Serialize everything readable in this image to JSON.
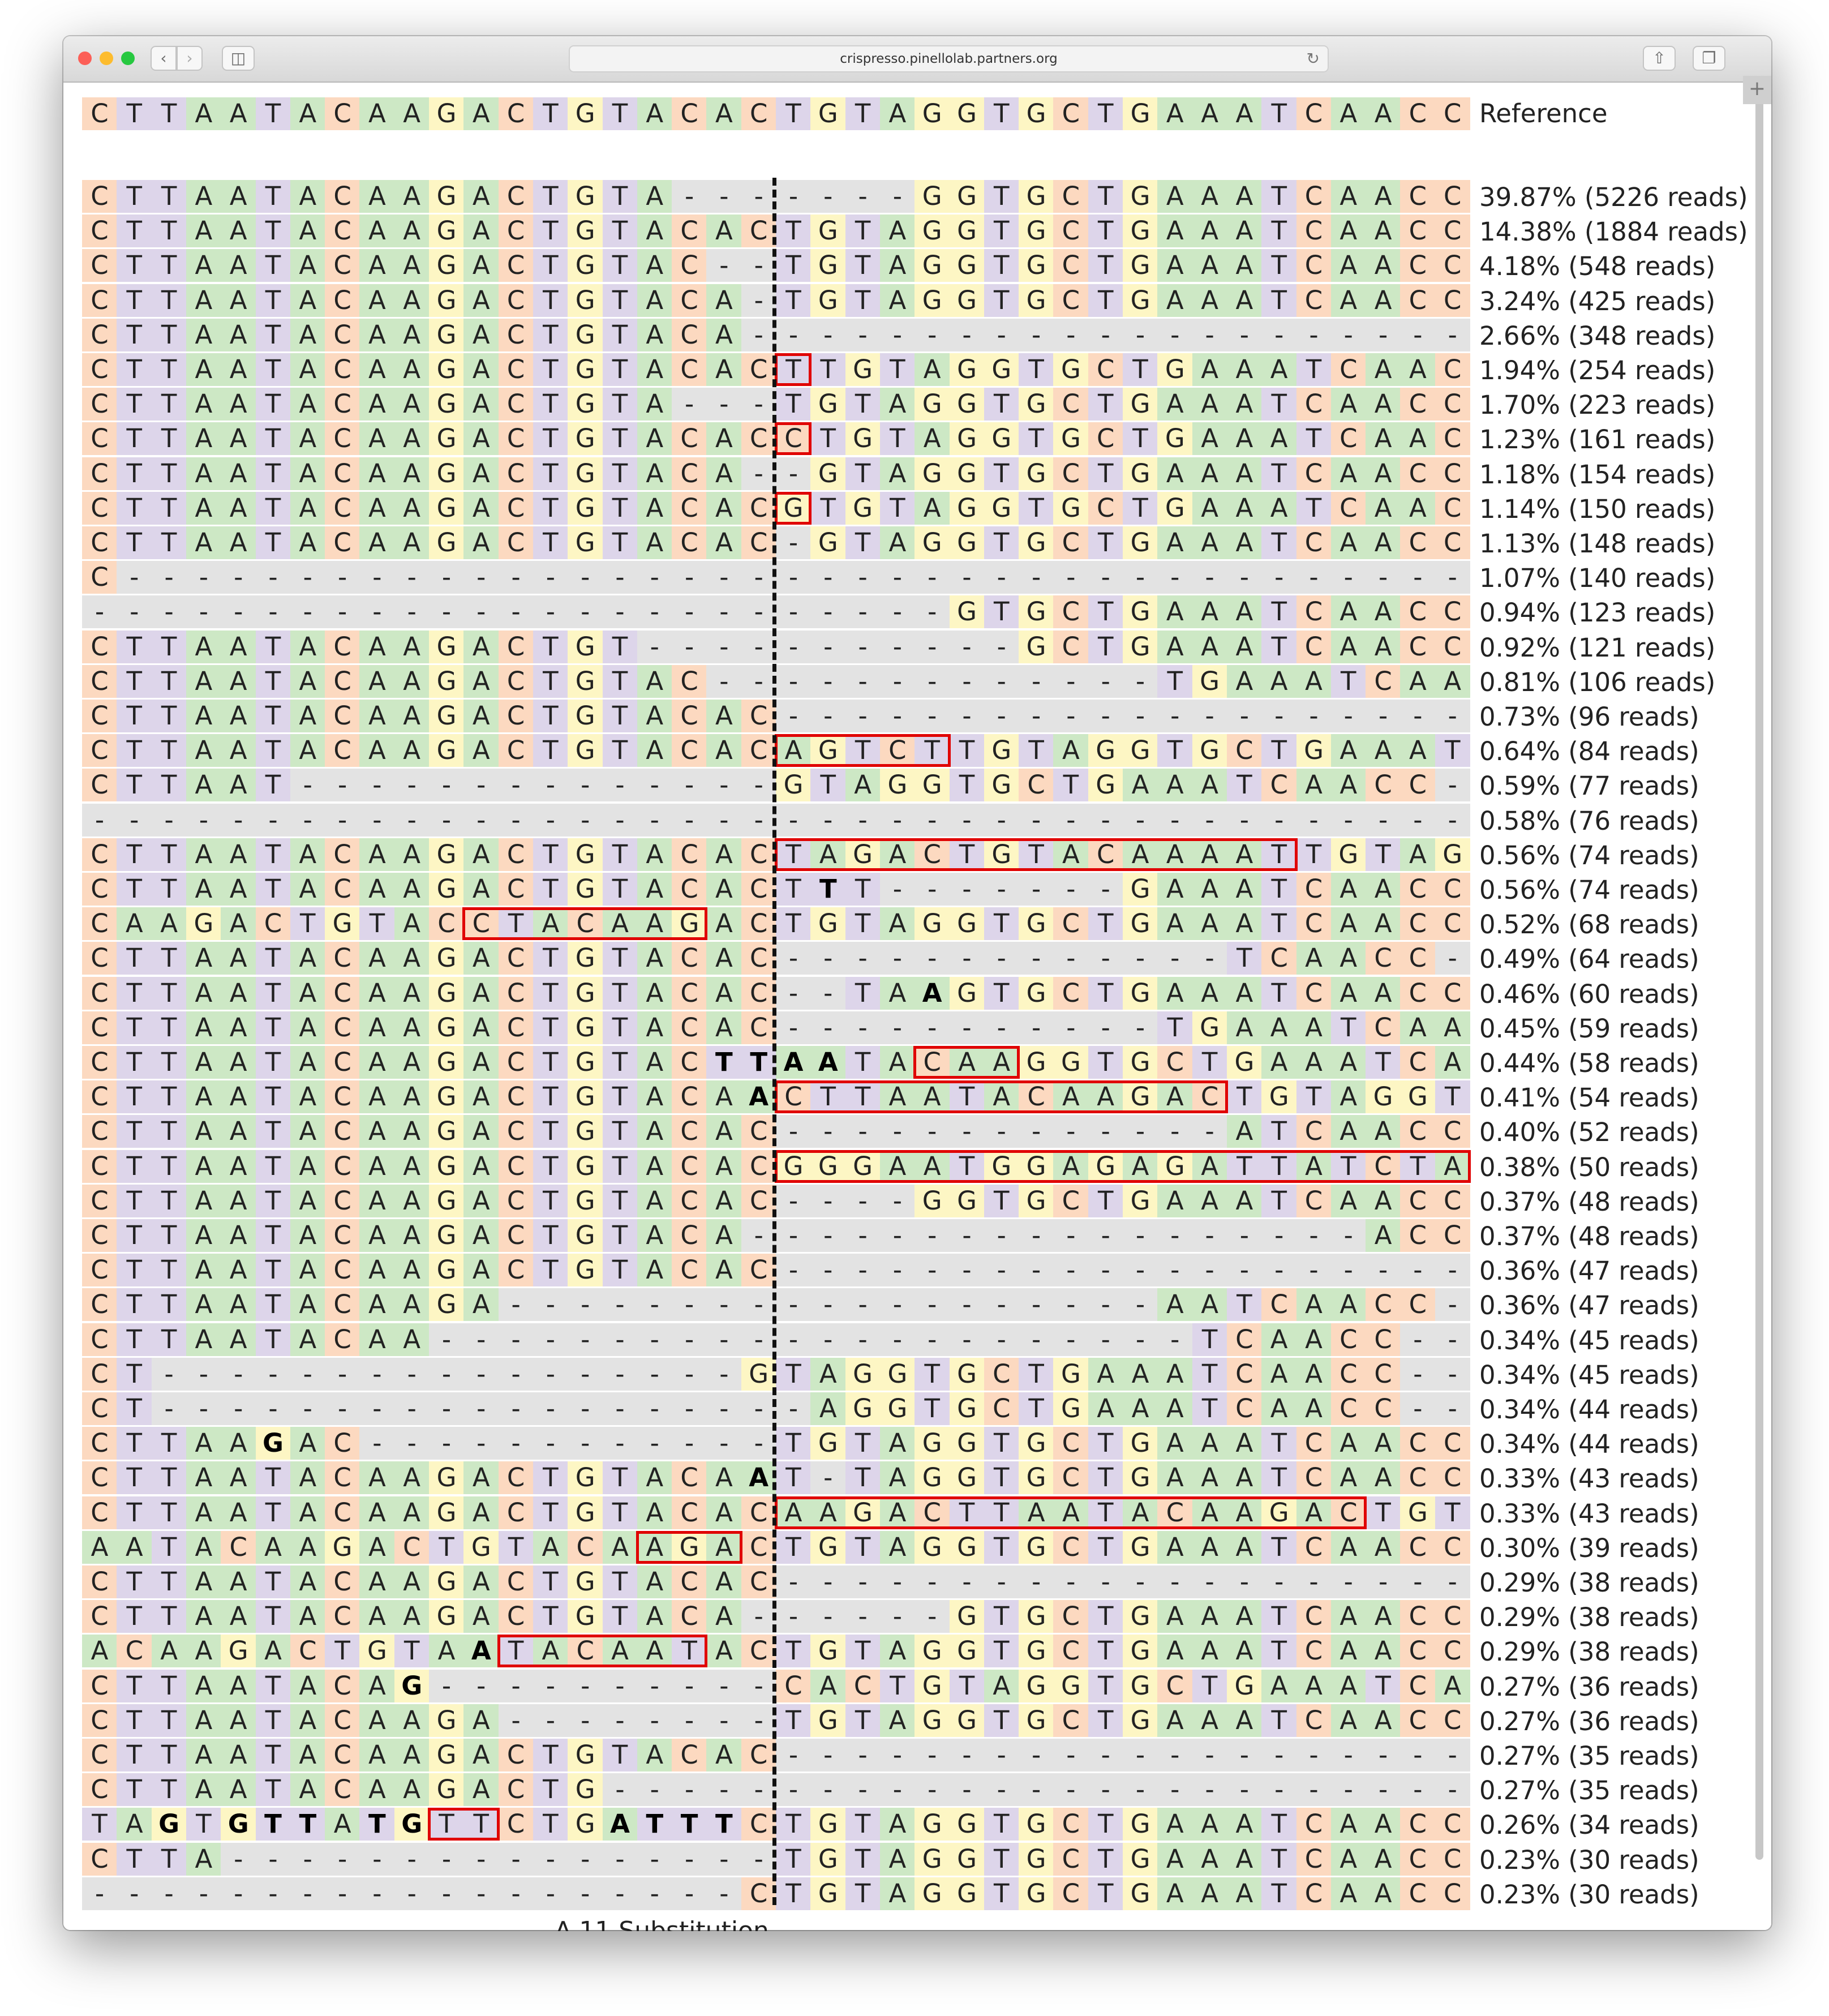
{
  "browser": {
    "url": "crispresso.pinellolab.partners.org",
    "icons": [
      "back-icon",
      "forward-icon",
      "sidebar-icon",
      "reload-icon",
      "share-icon",
      "tabs-icon",
      "new-tab-icon"
    ],
    "new_tab_glyph": "+"
  },
  "colors": {
    "A": "#cde8c5",
    "C": "#fcd9c0",
    "G": "#fdf6c4",
    "T": "#ddd5ea",
    "gap": "#e3e3e3",
    "insertion_box": "#e00000",
    "cut_line": "#111111"
  },
  "reference": {
    "sequence": "CTTAATACAAGACTGTACACTGTAGGTGCTGAAATCAACC",
    "label": "Reference"
  },
  "alleles": [
    {
      "seq": "CTTAATACAAGACTGTA-------GGTGCTGAAATCAACC",
      "label": "39.87% (5226 reads)",
      "bold": [],
      "ins": []
    },
    {
      "seq": "CTTAATACAAGACTGTACACTGTAGGTGCTGAAATCAACC",
      "label": "14.38% (1884 reads)",
      "bold": [],
      "ins": []
    },
    {
      "seq": "CTTAATACAAGACTGTAC--TGTAGGTGCTGAAATCAACC",
      "label": "4.18% (548 reads)",
      "bold": [],
      "ins": []
    },
    {
      "seq": "CTTAATACAAGACTGTACA-TGTAGGTGCTGAAATCAACC",
      "label": "3.24% (425 reads)",
      "bold": [],
      "ins": []
    },
    {
      "seq": "CTTAATACAAGACTGTACA---------------------",
      "label": "2.66% (348 reads)",
      "bold": [],
      "ins": []
    },
    {
      "seq": "CTTAATACAAGACTGTACACTTGTAGGTGCTGAAATCAAC",
      "label": "1.94% (254 reads)",
      "bold": [],
      "ins": [
        [
          20,
          1
        ]
      ]
    },
    {
      "seq": "CTTAATACAAGACTGTA---TGTAGGTGCTGAAATCAACC",
      "label": "1.70% (223 reads)",
      "bold": [],
      "ins": []
    },
    {
      "seq": "CTTAATACAAGACTGTACACCTGTAGGTGCTGAAATCAAC",
      "label": "1.23% (161 reads)",
      "bold": [],
      "ins": [
        [
          20,
          1
        ]
      ]
    },
    {
      "seq": "CTTAATACAAGACTGTACA--GTAGGTGCTGAAATCAACC",
      "label": "1.18% (154 reads)",
      "bold": [],
      "ins": []
    },
    {
      "seq": "CTTAATACAAGACTGTACACGTGTAGGTGCTGAAATCAAC",
      "label": "1.14% (150 reads)",
      "bold": [],
      "ins": [
        [
          20,
          1
        ]
      ]
    },
    {
      "seq": "CTTAATACAAGACTGTACAC-GTAGGTGCTGAAATCAACC",
      "label": "1.13% (148 reads)",
      "bold": [],
      "ins": []
    },
    {
      "seq": "C---------------------------------------C",
      "label": "1.07% (140 reads)",
      "bold": [],
      "ins": []
    },
    {
      "seq": "-------------------------GTGCTGAAATCAACC",
      "label": "0.94% (123 reads)",
      "bold": [],
      "ins": []
    },
    {
      "seq": "CTTAATACAAGACTGT-----------GCTGAAATCAACC",
      "label": "0.92% (121 reads)",
      "bold": [],
      "ins": []
    },
    {
      "seq": "CTTAATACAAGACTGTAC-------------TGAAATCAACC",
      "label": "0.81% (106 reads)",
      "bold": [],
      "ins": []
    },
    {
      "seq": "CTTAATACAAGACTGTACAC--------------------",
      "label": "0.73% (96 reads)",
      "bold": [],
      "ins": []
    },
    {
      "seq": "CTTAATACAAGACTGTACACAGTCTTGTAGGTGCTGAAAT",
      "label": "0.64% (84 reads)",
      "bold": [],
      "ins": [
        [
          20,
          5
        ]
      ]
    },
    {
      "seq": "CTTAAT--------------GTAGGTGCTGAAATCAACC",
      "label": "0.59% (77 reads)",
      "bold": [],
      "ins": []
    },
    {
      "seq": "----------------------------------------",
      "label": "0.58% (76 reads)",
      "bold": [],
      "ins": []
    },
    {
      "seq": "CTTAATACAAGACTGTACACTAGACTGTACAAAATTGTAG",
      "label": "0.56% (74 reads)",
      "bold": [],
      "ins": [
        [
          20,
          15
        ]
      ]
    },
    {
      "seq": "CTTAATACAAGACTGTACACTTT-------GAAATCAACC",
      "label": "0.56% (74 reads)",
      "bold": [
        21
      ],
      "ins": []
    },
    {
      "seq": "CAAGACTGTACCTACAAGACTGTAGGTGCTGAAATCAACC",
      "label": "0.52% (68 reads)",
      "bold": [],
      "ins": [
        [
          11,
          7
        ]
      ]
    },
    {
      "seq": "CTTAATACAAGACTGTACAC-------------TCAACC",
      "label": "0.49% (64 reads)",
      "bold": [],
      "ins": []
    },
    {
      "seq": "CTTAATACAAGACTGTACAC--TAAGTGCTGAAATCAACC",
      "label": "0.46% (60 reads)",
      "bold": [
        24
      ],
      "ins": []
    },
    {
      "seq": "CTTAATACAAGACTGTACAC-----------TGAAATCAACC",
      "label": "0.45% (59 reads)",
      "bold": [],
      "ins": []
    },
    {
      "seq": "CTTAATACAAGACTGTACTTAATACAAGGTGCTGAAATCA",
      "label": "0.44% (58 reads)",
      "bold": [
        18,
        19,
        20,
        21
      ],
      "ins": [
        [
          24,
          3
        ]
      ]
    },
    {
      "seq": "CTTAATACAAGACTGTACAACTTAATACAAGACTGTAGGT",
      "label": "0.41% (54 reads)",
      "bold": [
        19
      ],
      "ins": [
        [
          20,
          13
        ]
      ]
    },
    {
      "seq": "CTTAATACAAGACTGTACAC-------------ATCAACC",
      "label": "0.40% (52 reads)",
      "bold": [],
      "ins": []
    },
    {
      "seq": "CTTAATACAAGACTGTACACGGGAATGGAGAGATTATCTA",
      "label": "0.38% (50 reads)",
      "bold": [],
      "ins": [
        [
          20,
          20
        ]
      ]
    },
    {
      "seq": "CTTAATACAAGACTGTACAC----GGTGCTGAAATCAACC",
      "label": "0.37% (48 reads)",
      "bold": [],
      "ins": []
    },
    {
      "seq": "CTTAATACAAGACTGTACA------------------ACC",
      "label": "0.37% (48 reads)",
      "bold": [],
      "ins": []
    },
    {
      "seq": "CTTAATACAAGACTGTACAC--------------------",
      "label": "0.36% (47 reads)",
      "bold": [],
      "ins": []
    },
    {
      "seq": "CTTAATACAAGA-------------------AATCAACC",
      "label": "0.36% (47 reads)",
      "bold": [],
      "ins": []
    },
    {
      "seq": "CTTAATACAA----------------------TCAACC",
      "label": "0.34% (45 reads)",
      "bold": [],
      "ins": []
    },
    {
      "seq": "CT-----------------GTAGGTGCTGAAATCAACC",
      "label": "0.34% (45 reads)",
      "bold": [],
      "ins": []
    },
    {
      "seq": "CT-------------------AGGTGCTGAAATCAACC",
      "label": "0.34% (44 reads)",
      "bold": [],
      "ins": []
    },
    {
      "seq": "CTTAAGAC------------TGTAGGTGCTGAAATCAACC",
      "label": "0.34% (44 reads)",
      "bold": [
        5
      ],
      "ins": []
    },
    {
      "seq": "CTTAATACAAGACTGTACAAT-TAGGTGCTGAAATCAACC",
      "label": "0.33% (43 reads)",
      "bold": [
        19
      ],
      "ins": []
    },
    {
      "seq": "CTTAATACAAGACTGTACACAAGACTTAATACAAGACTGT",
      "label": "0.33% (43 reads)",
      "bold": [],
      "ins": [
        [
          20,
          17
        ]
      ]
    },
    {
      "seq": "AATACAAGACTGTACAAGACTGTAGGTGCTGAAATCAACC",
      "label": "0.30% (39 reads)",
      "bold": [],
      "ins": [
        [
          16,
          3
        ]
      ]
    },
    {
      "seq": "CTTAATACAAGACTGTACAC--------------------",
      "label": "0.29% (38 reads)",
      "bold": [],
      "ins": []
    },
    {
      "seq": "CTTAATACAAGACTGTACA------GTGCTGAAATCAACC",
      "label": "0.29% (38 reads)",
      "bold": [],
      "ins": []
    },
    {
      "seq": "ACAAGACTGTAATACAATACTGTAGGTGCTGAAATCAACC",
      "label": "0.29% (38 reads)",
      "bold": [
        11
      ],
      "ins": [
        [
          12,
          6
        ]
      ]
    },
    {
      "seq": "CTTAATACAG----------CACTGTAGGTGCTGAAATCAACC",
      "label": "0.27% (36 reads)",
      "bold": [
        9
      ],
      "ins": []
    },
    {
      "seq": "CTTAATACAAGA--------TGTAGGTGCTGAAATCAACC",
      "label": "0.27% (36 reads)",
      "bold": [],
      "ins": []
    },
    {
      "seq": "CTTAATACAAGACTGTACAC--------------------",
      "label": "0.27% (35 reads)",
      "bold": [],
      "ins": []
    },
    {
      "seq": "CTTAATACAAGACTG-------------------------",
      "label": "0.27% (35 reads)",
      "bold": [],
      "ins": []
    },
    {
      "seq": "TAGTGTTATGTTCTGATTTCTGTAGGTGCTGAAATCAACC",
      "label": "0.26% (34 reads)",
      "bold": [
        2,
        4,
        5,
        6,
        8,
        9,
        15,
        16,
        17,
        18
      ],
      "ins": [
        [
          10,
          2
        ]
      ]
    },
    {
      "seq": "CTTA----------------TGTAGGTGCTGAAATCAACC",
      "label": "0.23% (30 reads)",
      "bold": [],
      "ins": []
    },
    {
      "seq": "-------------------CTGTAGGTGCTGAAATCAACC",
      "label": "0.23% (30 reads)",
      "bold": [],
      "ins": []
    }
  ],
  "footer_partial": "A.11 Substitution"
}
